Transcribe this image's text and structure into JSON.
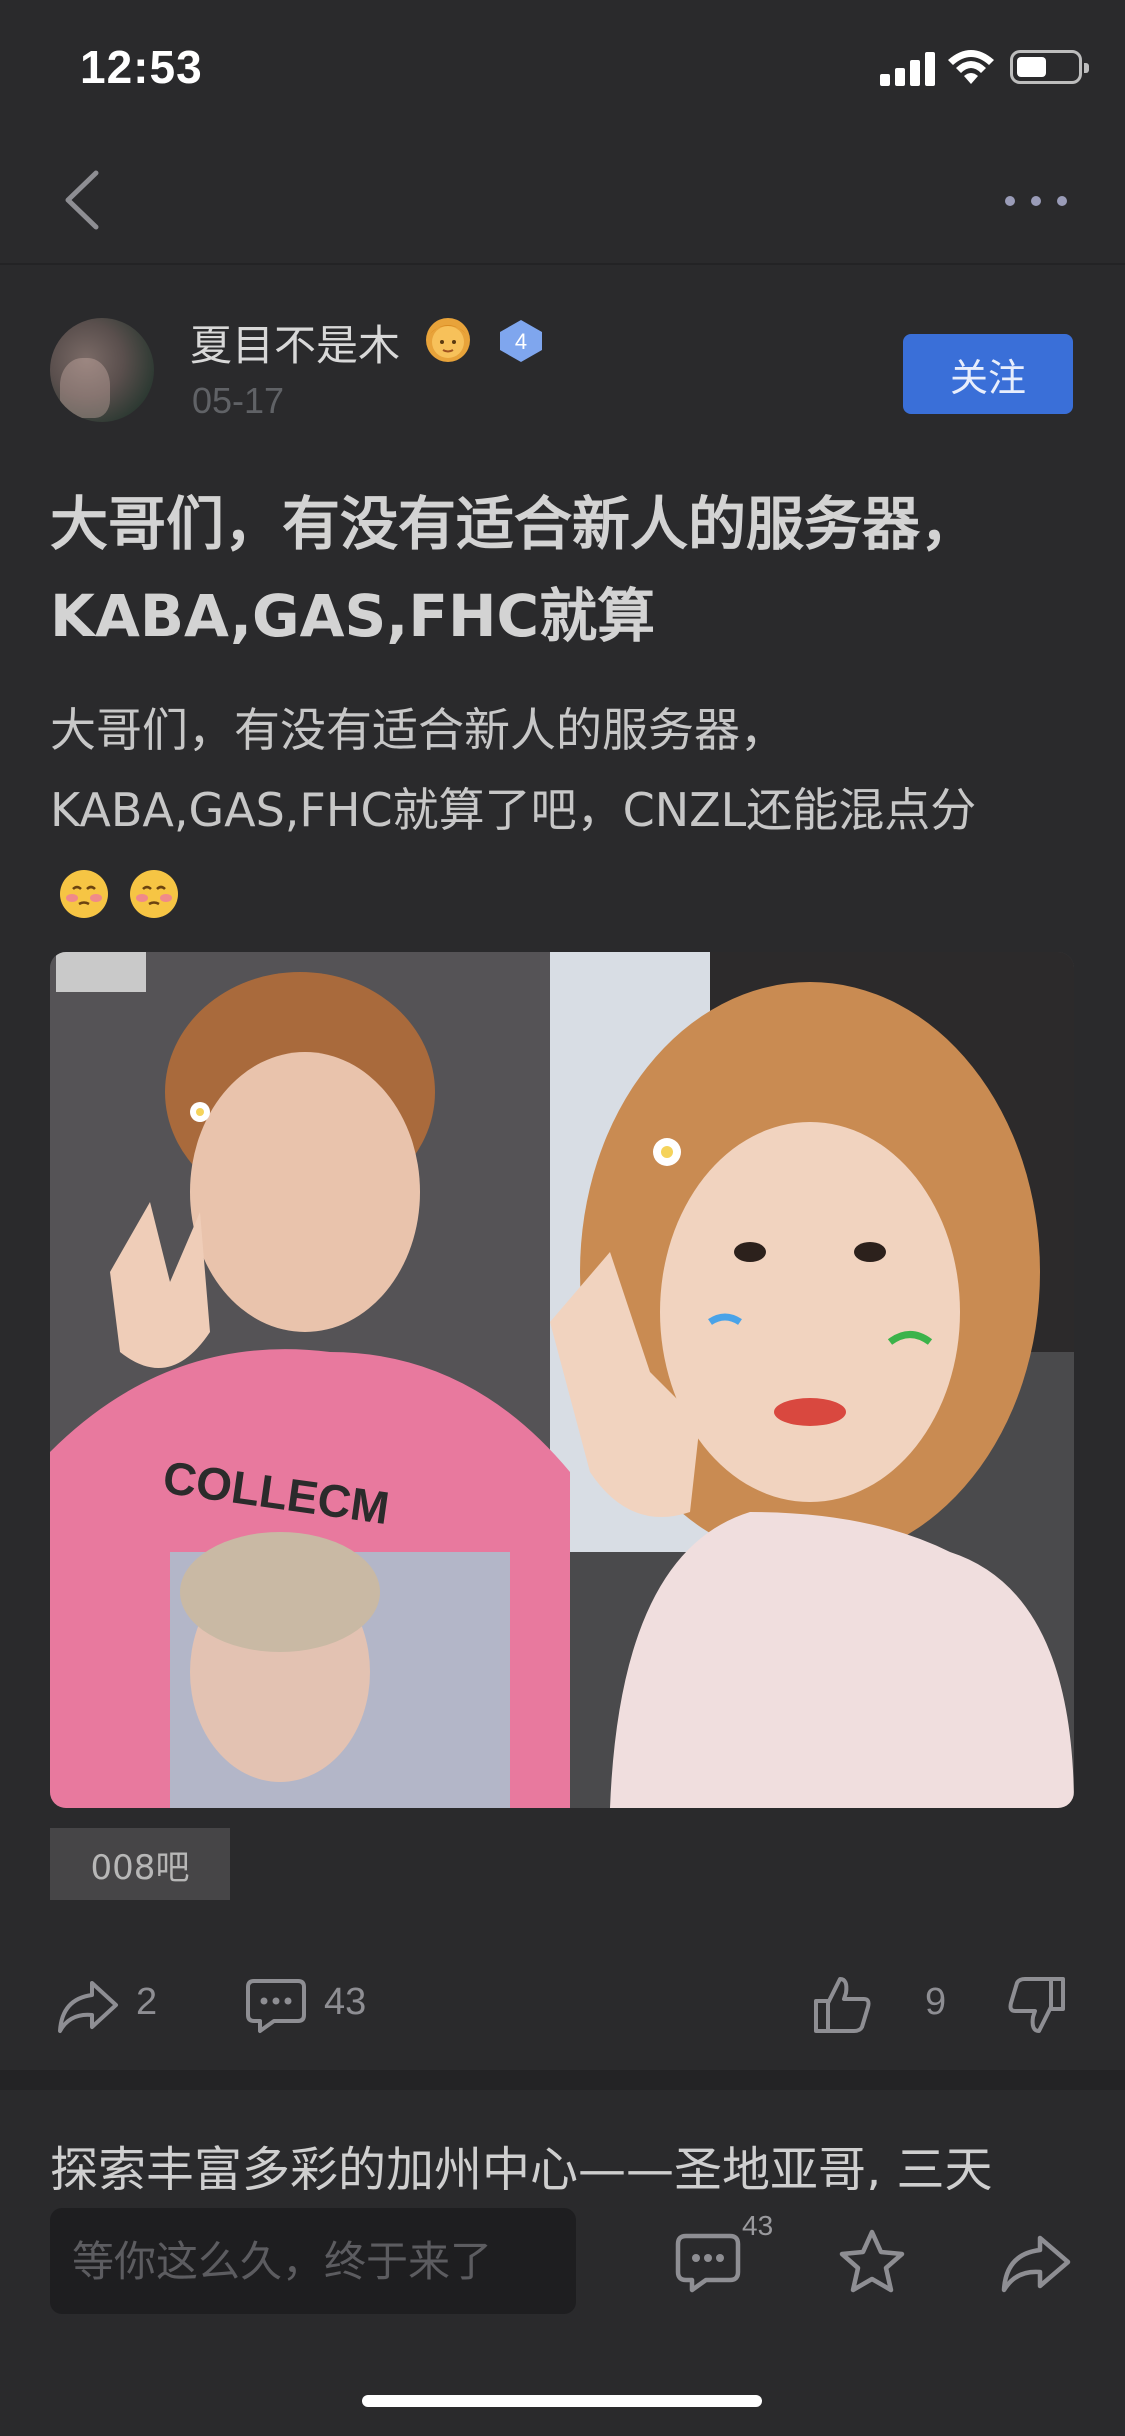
{
  "status_bar": {
    "time": "12:53",
    "battery_level": 0.5
  },
  "nav": {
    "back_icon": "chevron-left-icon",
    "more_icon": "more-dots-icon"
  },
  "author": {
    "name": "夏目不是木",
    "name_emoji": "girl-emoji",
    "level": "4",
    "date": "05-17",
    "follow_label": "关注"
  },
  "post": {
    "title": "大哥们，有没有适合新人的服务器，KABA,GAS,FHC就算",
    "body": "大哥们，有没有适合新人的服务器，KABA,GAS,FHC就算了吧，CNZL还能混点分",
    "body_emojis": [
      "blushing-face-emoji",
      "blushing-face-emoji"
    ],
    "photo": "selfie-photo",
    "tag": "008吧"
  },
  "actions": {
    "share_count": "2",
    "comment_count": "43",
    "like_count": "9"
  },
  "next_post": {
    "title": "探索丰富多彩的加州中心——圣地亚哥, 三天"
  },
  "bottom_bar": {
    "comment_placeholder": "等你这么久，终于来了",
    "comment_badge": "43"
  },
  "colors": {
    "accent": "#3a6fd8",
    "background": "#2a2a2c"
  }
}
